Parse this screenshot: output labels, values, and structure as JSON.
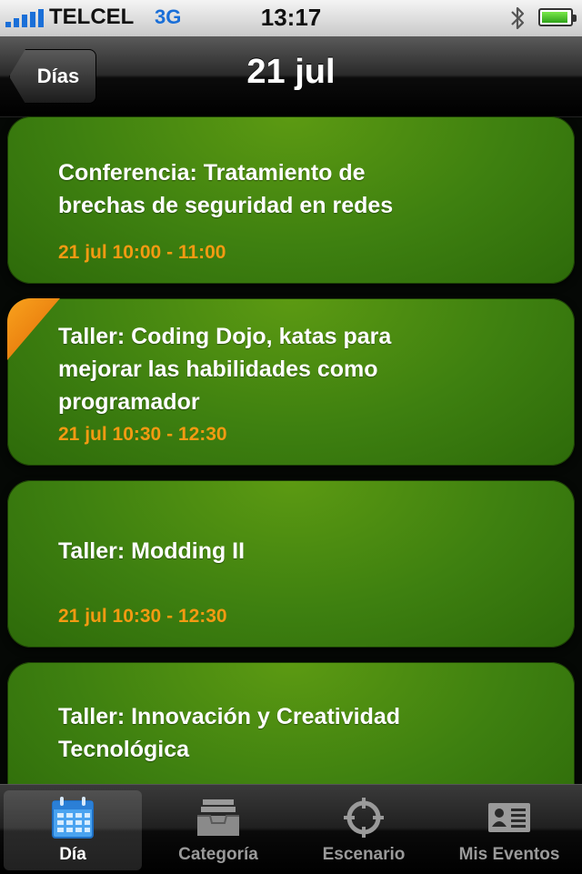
{
  "status_bar": {
    "carrier": "TELCEL",
    "network": "3G",
    "time": "13:17",
    "battery_level": 0.95
  },
  "nav": {
    "back_label": "Días",
    "title": "21 jul"
  },
  "events": [
    {
      "title_lines": [
        "Conferencia: Tratamiento de",
        "brechas de seguridad en redes"
      ],
      "time": "21 jul 10:00 - 11:00",
      "flagged": false
    },
    {
      "title_lines": [
        "Taller: Coding Dojo, katas para",
        "mejorar las habilidades como",
        "programador"
      ],
      "time": "21 jul 10:30 - 12:30",
      "flagged": true
    },
    {
      "title_lines": [
        "Taller: Modding II"
      ],
      "time": "21 jul 10:30 - 12:30",
      "flagged": false
    },
    {
      "title_lines": [
        "Taller: Innovación y Creatividad",
        "Tecnológica"
      ],
      "time": "",
      "flagged": false
    }
  ],
  "tabs": [
    {
      "label": "Día",
      "icon": "calendar-icon",
      "active": true
    },
    {
      "label": "Categoría",
      "icon": "inbox-tray-icon",
      "active": false
    },
    {
      "label": "Escenario",
      "icon": "crosshair-icon",
      "active": false
    },
    {
      "label": "Mis Eventos",
      "icon": "contact-card-icon",
      "active": false
    }
  ],
  "colors": {
    "card_green": "#3e8010",
    "time_orange": "#f39a12",
    "flag_orange": "#f08a12",
    "signal_blue": "#1a6fd8"
  }
}
